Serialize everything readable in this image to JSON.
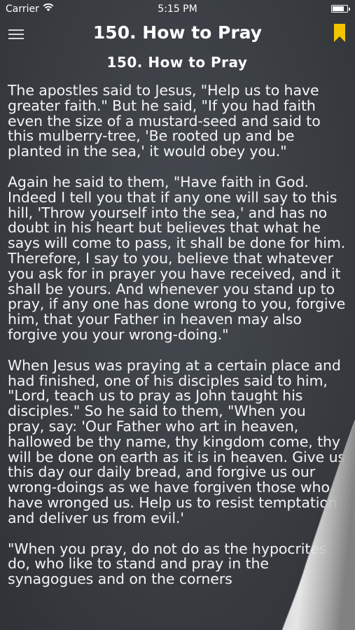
{
  "status_bar": {
    "carrier": "Carrier",
    "time": "5:15 PM",
    "battery_level": 0.9
  },
  "nav": {
    "title": "150. How to Pray",
    "menu_icon": "hamburger-menu-icon",
    "bookmark_icon": "bookmark-icon",
    "bookmark_color": "#f2c300"
  },
  "chapter": {
    "heading": "150. How to Pray",
    "paragraphs": [
      "The apostles said to Jesus, \"Help us to have greater faith.\" But he said, \"If you had faith even the size of a mustard-seed and said to this mulberry-tree, 'Be rooted up and be planted in the sea,' it would obey you.\"",
      "Again he said to them, \"Have faith in God. Indeed I tell you that if any one will say to this hill, 'Throw yourself into the sea,' and has no doubt in his heart but believes that what he says will come to pass, it shall be done for him. Therefore, I say to you, believe that whatever you ask for in prayer you have received, and it shall be yours. And whenever you stand up to pray, if any one has done wrong to you, forgive him, that your Father in heaven may also forgive you your wrong-doing.\"",
      "When Jesus was praying at a certain place and had finished, one of his disciples said to him, \"Lord, teach us to pray as John taught his disciples.\" So he said to them, \"When you pray, say: 'Our Father who art in heaven, hallowed be thy name, thy kingdom come, thy will be done on earth as it is in heaven. Give us this day our daily bread, and forgive us our wrong-doings as we have forgiven those who have wronged us. Help us to resist temptation and deliver us from evil.'",
      "\"When you pray, do not do as the hypocrites do, who like to stand and pray in the synagogues and on the corners"
    ]
  }
}
